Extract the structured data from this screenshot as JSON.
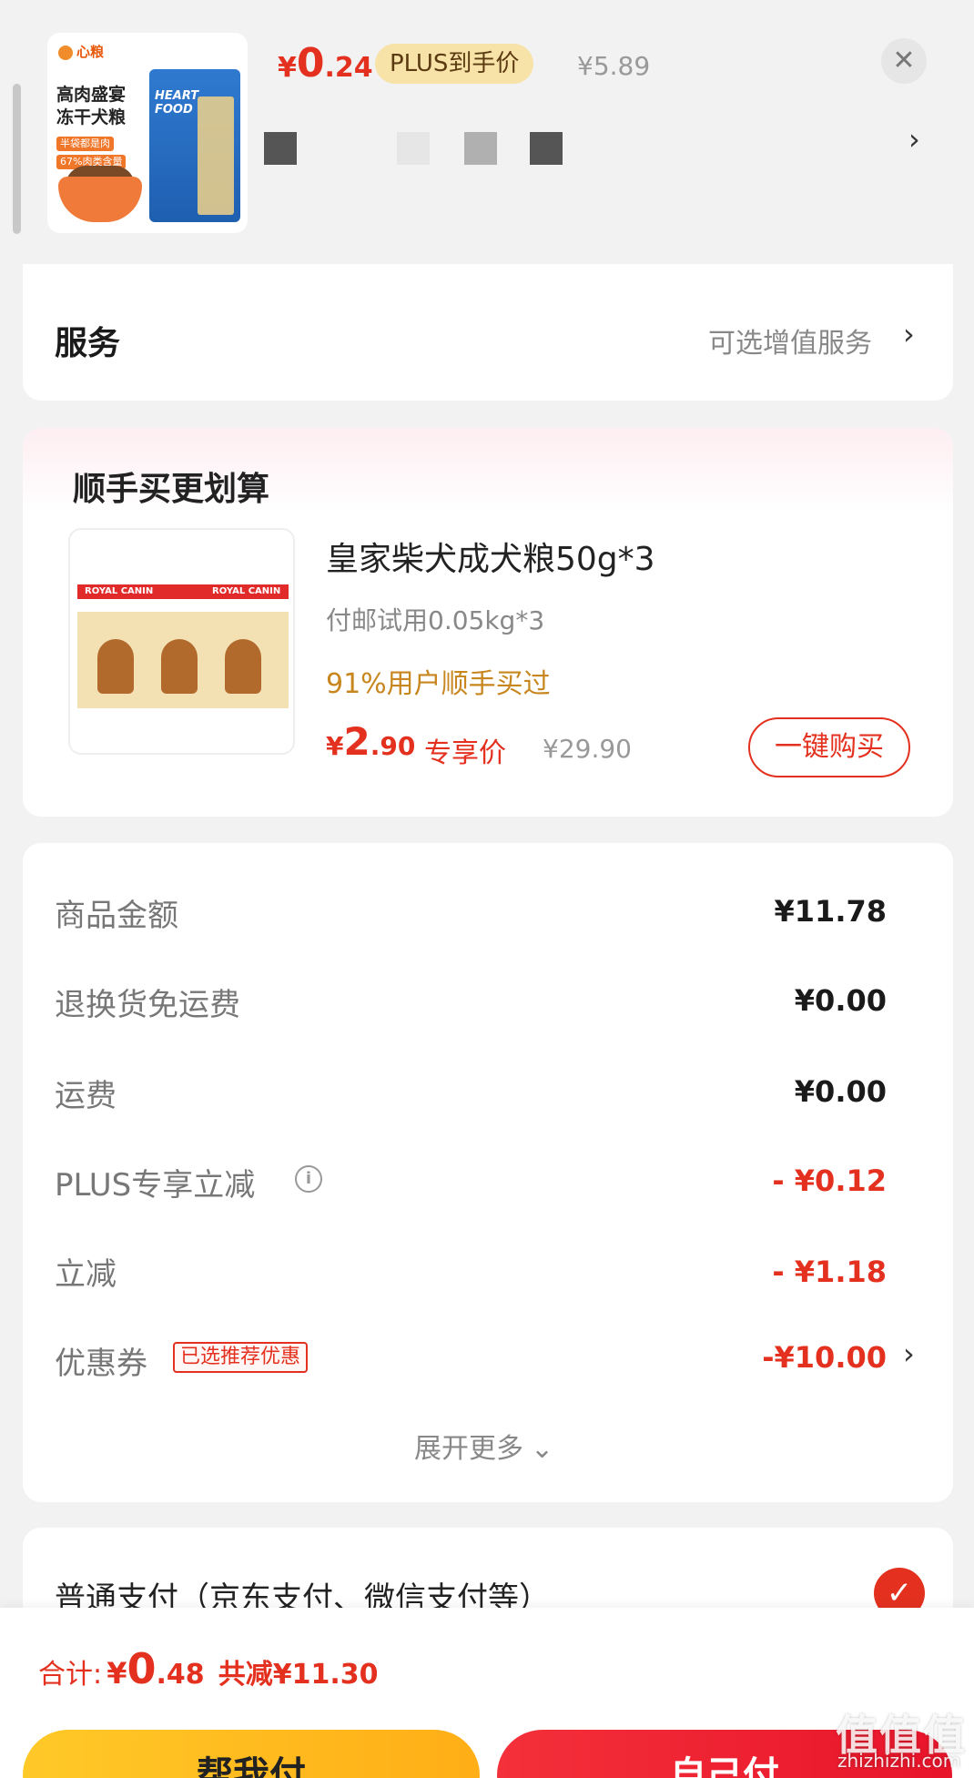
{
  "product": {
    "thumb_brand": "心粮",
    "thumb_title": "高肉盛宴 冻干犬粮",
    "thumb_tag1": "半袋都是肉",
    "thumb_tag2": "67%肉类含量",
    "bag_text": "HEART FOOD",
    "price_currency": "¥",
    "price_int": "0",
    "price_dec": ".24",
    "plus_tag": "PLUS到手价",
    "original_price": "¥5.89",
    "close_symbol": "✕",
    "swatch_colors": [
      "#555555",
      "#e6e6e6",
      "#b0b0b0",
      "#555555"
    ],
    "more_symbol": "›"
  },
  "service": {
    "title": "服务",
    "right_label": "可选增值服务",
    "chevron": "›"
  },
  "addon": {
    "title": "顺手买更划算",
    "image_brand": "ROYAL CANIN",
    "name": "皇家柴犬成犬粮50g*3",
    "subtitle": "付邮试用0.05kg*3",
    "popularity": "91%用户顺手买过",
    "price_currency": "¥",
    "price_int": "2",
    "price_dec": ".90",
    "exclusive": "专享价",
    "original_price": "¥29.90",
    "buy_button": "一键购买"
  },
  "summary": {
    "rows": [
      {
        "label": "商品金额",
        "value": "¥11.78"
      },
      {
        "label": "退换货免运费",
        "value": "¥0.00"
      },
      {
        "label": "运费",
        "value": "¥0.00"
      },
      {
        "label": "PLUS专享立减",
        "value": "- ¥0.12"
      },
      {
        "label": "立减",
        "value": "- ¥1.18"
      },
      {
        "label": "优惠券",
        "value": "-¥10.00"
      }
    ],
    "info_icon": "i",
    "coupon_tag": "已选推荐优惠",
    "coupon_chevron": "›",
    "expand_label": "展开更多",
    "expand_chevron": "⌄"
  },
  "payment": {
    "label": "普通支付（京东支付、微信支付等）",
    "check_symbol": "✓"
  },
  "bottom": {
    "total_label": "合计:",
    "total_currency": "¥",
    "total_int": "0",
    "total_dec": ".48",
    "saved": "共减¥11.30",
    "help_pay": "帮我付",
    "self_pay": "自己付"
  },
  "watermark": {
    "chars": "值值值",
    "url": "zhizhizhi.com"
  },
  "colors": {
    "accent_red": "#e4311f",
    "plus_gold": "#f7e2a8",
    "help_yellow": "#ffc928"
  }
}
